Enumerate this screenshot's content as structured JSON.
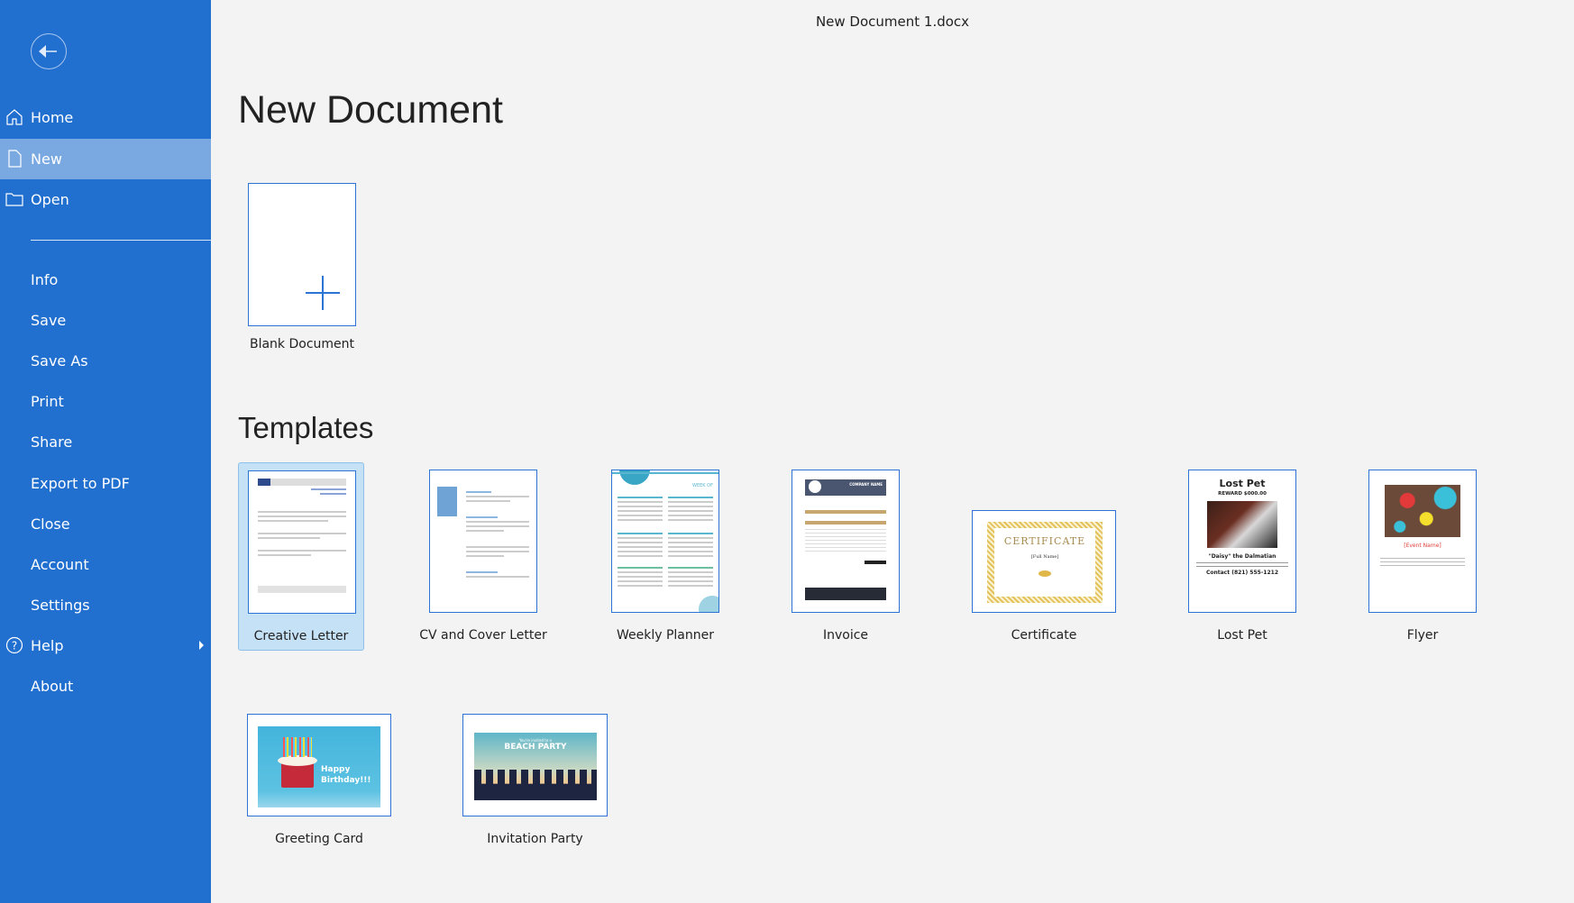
{
  "window": {
    "title": "New Document 1.docx"
  },
  "sidebar": {
    "back_label": "Back",
    "items": [
      {
        "label": "Home",
        "icon": "home-icon"
      },
      {
        "label": "New",
        "icon": "new-doc-icon",
        "selected": true
      },
      {
        "label": "Open",
        "icon": "folder-icon"
      },
      {
        "label": "Info"
      },
      {
        "label": "Save"
      },
      {
        "label": "Save As"
      },
      {
        "label": "Print"
      },
      {
        "label": "Share"
      },
      {
        "label": "Export to PDF"
      },
      {
        "label": "Close"
      },
      {
        "label": "Account"
      },
      {
        "label": "Settings"
      },
      {
        "label": "Help",
        "icon": "help-icon"
      },
      {
        "label": "About"
      }
    ]
  },
  "main": {
    "title": "New Document",
    "blank": {
      "label": "Blank Document"
    },
    "templates_heading": "Templates",
    "templates": [
      {
        "label": "Creative Letter",
        "selected": true
      },
      {
        "label": "CV and Cover Letter"
      },
      {
        "label": "Weekly Planner",
        "thumb_text": "WEEK OF"
      },
      {
        "label": "Invoice",
        "thumb_text": "COMPANY NAME"
      },
      {
        "label": "Certificate",
        "thumb_text": "CERTIFICATE",
        "thumb_sub": "[Full Name]"
      },
      {
        "label": "Lost Pet",
        "thumb_text": "Lost Pet",
        "thumb_sub": "REWARD $000.00",
        "thumb_name": "\"Daisy\" the Dalmatian",
        "thumb_contact": "Contact (821) 555-1212"
      },
      {
        "label": "Flyer",
        "thumb_text": "[Event Name]"
      },
      {
        "label": "Greeting Card",
        "thumb_text": "Happy Birthday!!!"
      },
      {
        "label": "Invitation Party",
        "thumb_text": "BEACH PARTY",
        "thumb_sub": "You're invited to a"
      }
    ]
  },
  "colors": {
    "sidebar": "#216fcf",
    "selected": "#7aa9e2",
    "accent": "#2b73d4"
  }
}
